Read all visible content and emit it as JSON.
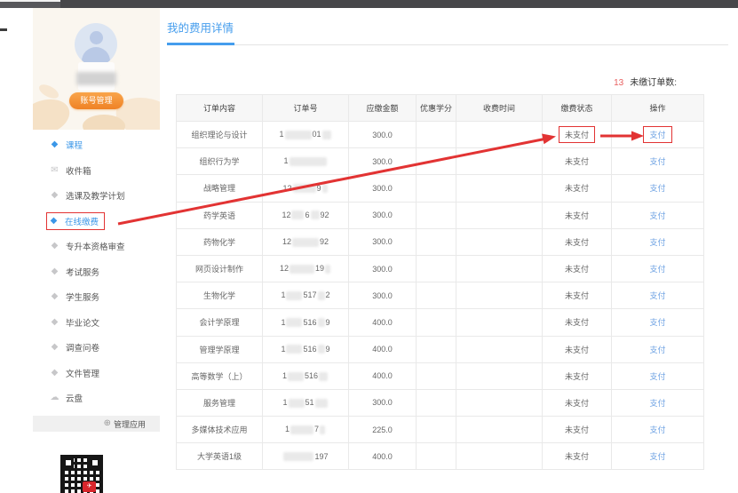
{
  "colors": {
    "accent_blue": "#459ded",
    "link_blue": "#6fa3e3",
    "annotation_red": "#e23333",
    "button_orange": "#f5913a",
    "count_red": "#e85f5f"
  },
  "sidebar": {
    "account_button": "账号管理",
    "manage_apps": "管理应用",
    "items": [
      {
        "label": "课程",
        "icon": "gem-icon",
        "active": true,
        "boxed": false
      },
      {
        "label": "收件箱",
        "icon": "envelope-icon",
        "active": false,
        "boxed": false
      },
      {
        "label": "选课及教学计划",
        "icon": "gem-icon",
        "active": false,
        "boxed": false
      },
      {
        "label": "在线缴费",
        "icon": "gem-icon",
        "active": true,
        "boxed": true
      },
      {
        "label": "专升本资格审查",
        "icon": "gem-icon",
        "active": false,
        "boxed": false
      },
      {
        "label": "考试服务",
        "icon": "gem-icon",
        "active": false,
        "boxed": false
      },
      {
        "label": "学生服务",
        "icon": "gem-icon",
        "active": false,
        "boxed": false
      },
      {
        "label": "毕业论文",
        "icon": "gem-icon",
        "active": false,
        "boxed": false
      },
      {
        "label": "调查问卷",
        "icon": "gem-icon",
        "active": false,
        "boxed": false
      },
      {
        "label": "文件管理",
        "icon": "gem-icon",
        "active": false,
        "boxed": false
      },
      {
        "label": "云盘",
        "icon": "cloud-icon",
        "active": false,
        "boxed": false
      }
    ]
  },
  "main": {
    "title": "我的费用详情",
    "unpaid_count": "13",
    "unpaid_label": "未缴订单数:",
    "table": {
      "headers": [
        "订单内容",
        "订单号",
        "应缴金额",
        "优惠学分",
        "收费时间",
        "缴费状态",
        "操作"
      ],
      "rows": [
        {
          "content": "组织理论与设计",
          "order_no": [
            {
              "t": "1"
            },
            {
              "b": 30
            },
            {
              "t": "01"
            },
            {
              "b": 10
            }
          ],
          "amount": "300.0",
          "discount": "",
          "time": "",
          "status": "未支付",
          "action": "支付",
          "highlight": true
        },
        {
          "content": "组织行为学",
          "order_no": [
            {
              "t": "1"
            },
            {
              "b": 42
            }
          ],
          "amount": "300.0",
          "discount": "",
          "time": "",
          "status": "未支付",
          "action": "支付",
          "highlight": false
        },
        {
          "content": "战略管理",
          "order_no": [
            {
              "t": "12"
            },
            {
              "b": 26
            },
            {
              "t": "9"
            },
            {
              "b": 6
            }
          ],
          "amount": "300.0",
          "discount": "",
          "time": "",
          "status": "未支付",
          "action": "支付",
          "highlight": false
        },
        {
          "content": "药学英语",
          "order_no": [
            {
              "t": "12"
            },
            {
              "b": 14
            },
            {
              "t": "6"
            },
            {
              "b": 10
            },
            {
              "t": "92"
            }
          ],
          "amount": "300.0",
          "discount": "",
          "time": "",
          "status": "未支付",
          "action": "支付",
          "highlight": false
        },
        {
          "content": "药物化学",
          "order_no": [
            {
              "t": "12"
            },
            {
              "b": 30
            },
            {
              "t": "92"
            }
          ],
          "amount": "300.0",
          "discount": "",
          "time": "",
          "status": "未支付",
          "action": "支付",
          "highlight": false
        },
        {
          "content": "网页设计制作",
          "order_no": [
            {
              "t": "12"
            },
            {
              "b": 28
            },
            {
              "t": "19"
            },
            {
              "b": 6
            }
          ],
          "amount": "300.0",
          "discount": "",
          "time": "",
          "status": "未支付",
          "action": "支付",
          "highlight": false
        },
        {
          "content": "生物化学",
          "order_no": [
            {
              "t": "1"
            },
            {
              "b": 18
            },
            {
              "t": "517"
            },
            {
              "b": 8
            },
            {
              "t": "2"
            }
          ],
          "amount": "300.0",
          "discount": "",
          "time": "",
          "status": "未支付",
          "action": "支付",
          "highlight": false
        },
        {
          "content": "会计学原理",
          "order_no": [
            {
              "t": "1"
            },
            {
              "b": 18
            },
            {
              "t": "516"
            },
            {
              "b": 8
            },
            {
              "t": "9"
            }
          ],
          "amount": "400.0",
          "discount": "",
          "time": "",
          "status": "未支付",
          "action": "支付",
          "highlight": false
        },
        {
          "content": "管理学原理",
          "order_no": [
            {
              "t": "1"
            },
            {
              "b": 18
            },
            {
              "t": "516"
            },
            {
              "b": 8
            },
            {
              "t": "9"
            }
          ],
          "amount": "400.0",
          "discount": "",
          "time": "",
          "status": "未支付",
          "action": "支付",
          "highlight": false
        },
        {
          "content": "高等数学（上）",
          "order_no": [
            {
              "t": "1"
            },
            {
              "b": 18
            },
            {
              "t": "516"
            },
            {
              "b": 10
            }
          ],
          "amount": "400.0",
          "discount": "",
          "time": "",
          "status": "未支付",
          "action": "支付",
          "highlight": false
        },
        {
          "content": "服务管理",
          "order_no": [
            {
              "t": "1"
            },
            {
              "b": 18
            },
            {
              "t": "51"
            },
            {
              "b": 14
            }
          ],
          "amount": "300.0",
          "discount": "",
          "time": "",
          "status": "未支付",
          "action": "支付",
          "highlight": false
        },
        {
          "content": "多媒体技术应用",
          "order_no": [
            {
              "t": "1"
            },
            {
              "b": 26
            },
            {
              "t": "7"
            },
            {
              "b": 6
            }
          ],
          "amount": "225.0",
          "discount": "",
          "time": "",
          "status": "未支付",
          "action": "支付",
          "highlight": false
        },
        {
          "content": "大学英语1级",
          "order_no": [
            {
              "b": 34
            },
            {
              "t": "197"
            }
          ],
          "amount": "400.0",
          "discount": "",
          "time": "",
          "status": "未支付",
          "action": "支付",
          "highlight": false
        }
      ]
    }
  }
}
